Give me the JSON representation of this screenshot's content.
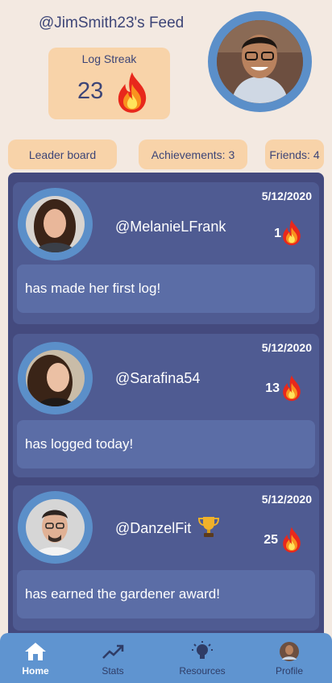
{
  "header": {
    "feed_title": "@JimSmith23's Feed",
    "streak_label": "Log Streak",
    "streak_value": "23"
  },
  "pills": {
    "leaderboard": "Leader board",
    "achievements": "Achievements: 3",
    "friends": "Friends: 4"
  },
  "posts": [
    {
      "username": "@MelanieLFrank",
      "date": "5/12/2020",
      "count": "1",
      "message": "has made her first log!"
    },
    {
      "username": "@Sarafina54",
      "date": "5/12/2020",
      "count": "13",
      "message": "has logged today!"
    },
    {
      "username": "@DanzelFit",
      "date": "5/12/2020",
      "count": "25",
      "message": "has earned the gardener award!"
    }
  ],
  "nav": {
    "home": "Home",
    "stats": "Stats",
    "resources": "Resources",
    "profile": "Profile"
  },
  "colors": {
    "background": "#f3e9e1",
    "accent": "#f8d3a9",
    "panel": "#444a7e",
    "nav": "#5f94d0"
  }
}
